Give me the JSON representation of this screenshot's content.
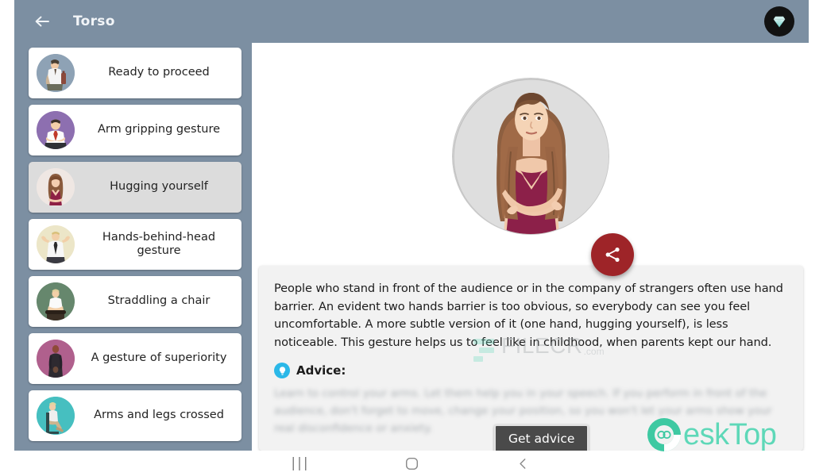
{
  "app": {
    "title": "Torso",
    "back_icon": "arrow-left-icon",
    "premium_icon": "diamond-icon"
  },
  "sidebar": {
    "items": [
      {
        "label": "Ready to proceed",
        "icon": "avatar-man-briefcase-icon",
        "avatar_bg": "#8ea2b5",
        "selected": false
      },
      {
        "label": "Arm gripping gesture",
        "icon": "avatar-man-tie-icon",
        "avatar_bg": "#8d6fb0",
        "selected": false
      },
      {
        "label": "Hugging yourself",
        "icon": "avatar-woman-hug-icon",
        "avatar_bg": "#efe7e3",
        "selected": true
      },
      {
        "label": "Hands-behind-head gesture",
        "icon": "avatar-man-hands-head-icon",
        "avatar_bg": "#ece6c8",
        "selected": false
      },
      {
        "label": "Straddling a chair",
        "icon": "avatar-man-chair-icon",
        "avatar_bg": "#66876d",
        "selected": false
      },
      {
        "label": "A gesture of superiority",
        "icon": "avatar-superiority-icon",
        "avatar_bg": "#b0608d",
        "selected": false
      },
      {
        "label": "Arms and legs crossed",
        "icon": "avatar-legs-crossed-icon",
        "avatar_bg": "#46bfc0",
        "selected": false
      }
    ]
  },
  "main": {
    "hero_image_alt": "woman-hugging-herself-illustration",
    "share_button": {
      "icon": "share-icon",
      "color": "#9e2428"
    },
    "body_text": "People who stand in front of the audience or in the company of strangers often use hand barrier. An evident two hands barrier is too obvious, so everybody can see you feel uncomfortable. A more subtle version of it (one hand, hugging yourself), is less noticeable. This gesture helps us to feel like in childhood, when parents kept our hand.",
    "advice": {
      "icon": "lightbulb-icon",
      "label": "Advice:",
      "blurred_text": "Learn to control your arms. Let them help you in your speech. If you perform in front of the audience, don't forget to move, change your position, so you won't let your arms show your real disconfidence or anxiety.",
      "button_label": "Get advice"
    }
  },
  "watermarks": {
    "filecr": {
      "name": "FILECR",
      "suffix": ".com",
      "color": "#8e9499",
      "accent": "#63d8bb"
    },
    "desktop": {
      "name": "esk",
      "name2": "Top",
      "color": "#5ed8b8"
    }
  },
  "navbar": {
    "recents": {
      "icon": "recents-icon",
      "glyph": "|||"
    },
    "home": {
      "icon": "home-circle-icon"
    },
    "back": {
      "icon": "back-chevron-icon"
    }
  },
  "colors": {
    "header_bg": "#7c8fa2",
    "card_bg": "#f2f2f2",
    "selected_item_bg": "#dcdcdc",
    "fab": "#9e2428",
    "advice_accent": "#2bb8e8"
  }
}
